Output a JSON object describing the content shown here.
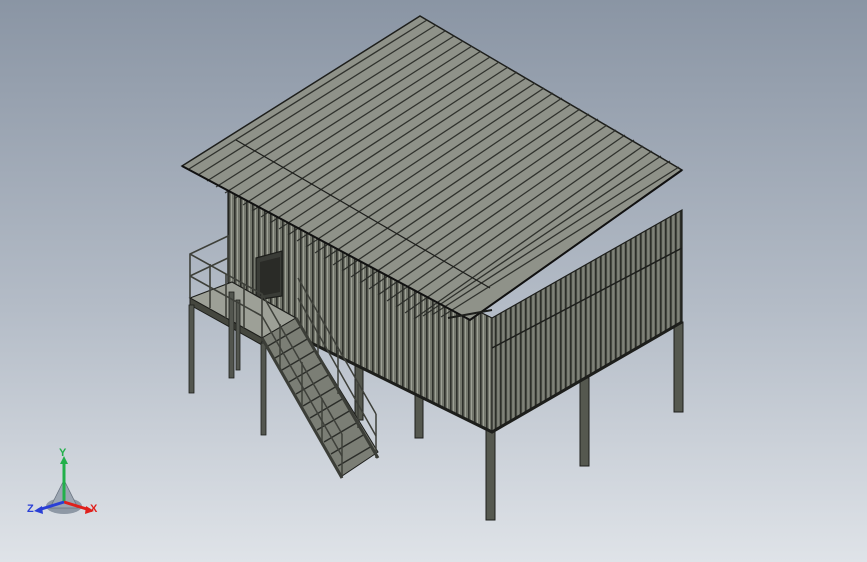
{
  "colors": {
    "wall": "#6e7166",
    "wall_light": "#8f9389",
    "roof": "#8a8d84",
    "roof_dark": "#5f625a",
    "steel": "#53564f",
    "axis_x": "#e0201c",
    "axis_y": "#22b04a",
    "axis_z": "#2a3fd6"
  },
  "triad": {
    "x_label": "X",
    "y_label": "Y",
    "z_label": "Z"
  }
}
